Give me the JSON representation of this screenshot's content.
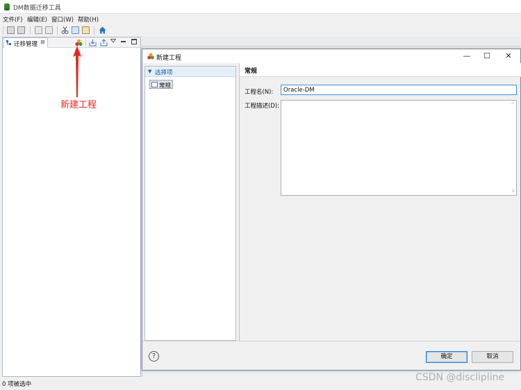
{
  "app": {
    "title": "DM数据迁移工具"
  },
  "menubar": {
    "items": [
      "文件(F)",
      "编辑(E)",
      "窗口(W)",
      "帮助(H)"
    ]
  },
  "left_panel": {
    "tab_label": "迁移管理",
    "tab_close": "⊠",
    "toolbar_icons": [
      "new-project-icon",
      "import-icon",
      "export-icon",
      "view-menu-icon",
      "minimize-icon",
      "maximize-icon"
    ]
  },
  "annotation": {
    "text": "新建工程",
    "color": "#e8261f"
  },
  "dialog": {
    "title": "新建工程",
    "window_controls": [
      "—",
      "☐",
      "✕"
    ],
    "nav": {
      "header": "选择项",
      "items": [
        "常规"
      ]
    },
    "content": {
      "header": "常规",
      "name_label": "工程名(N):",
      "name_value": "Oracle-DM",
      "desc_label": "工程描述(D):",
      "desc_value": ""
    },
    "buttons": {
      "help": "?",
      "ok": "确定",
      "cancel": "取消"
    }
  },
  "statusbar": {
    "text": "0 项被选中"
  },
  "watermark": "CSDN @disclipline"
}
